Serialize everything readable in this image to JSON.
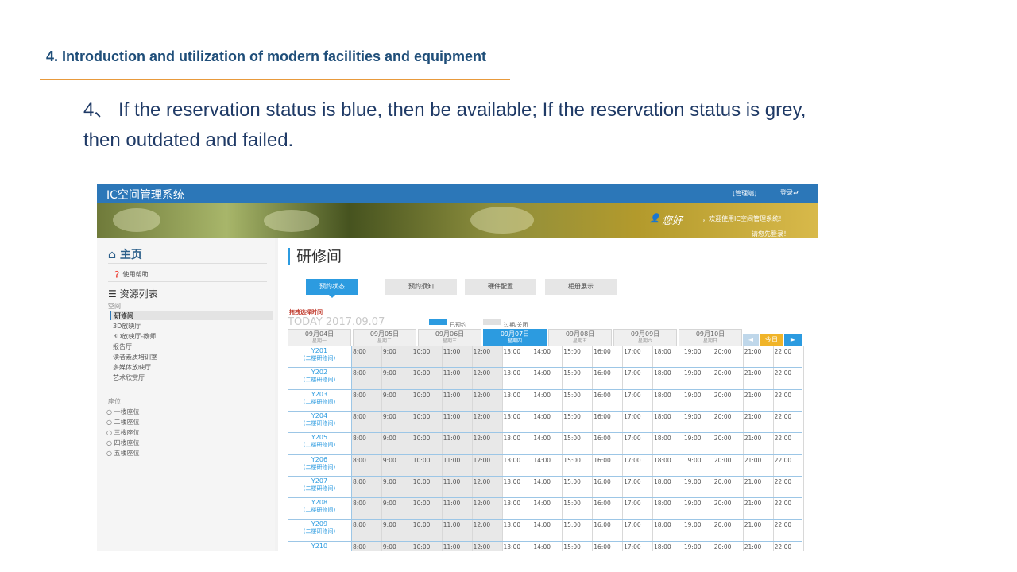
{
  "slide": {
    "heading": "4. Introduction and utilization of modern facilities and equipment",
    "body": "4、 If the reservation status is blue, then be available; If the reservation status is grey, then outdated and failed."
  },
  "app": {
    "title": "IC空间管理系统",
    "admin_link": "[管理端]",
    "login_link": "登录⮐",
    "welcome": "您好",
    "welcome_sub1": "，欢迎使用IC空间管理系统！",
    "welcome_sub2": "请您先登录！"
  },
  "sidebar": {
    "home": "主页",
    "help": "使用帮助",
    "resources": "资源列表",
    "group_space": "空间",
    "items": [
      "研修间",
      "3D放映厅",
      "3D放映厅-教师",
      "报告厅",
      "读者素质培训室",
      "多媒体放映厅",
      "艺术欣赏厅"
    ],
    "group_seat": "座位",
    "seats": [
      "一楼座位",
      "二楼座位",
      "三楼座位",
      "四楼座位",
      "五楼座位"
    ]
  },
  "main": {
    "room_title": "研修间",
    "tabs": [
      "预约状态",
      "预约须知",
      "硬件配置",
      "相册展示"
    ],
    "pick_label": "拖拽选择时间",
    "today": "TODAY 2017.09.07",
    "legend_booked": "已预约",
    "legend_expired": "过期/关闭",
    "days": [
      {
        "date": "09月04日",
        "week": "星期一"
      },
      {
        "date": "09月05日",
        "week": "星期二"
      },
      {
        "date": "09月06日",
        "week": "星期三"
      },
      {
        "date": "09月07日",
        "week": "星期四"
      },
      {
        "date": "09月08日",
        "week": "星期五"
      },
      {
        "date": "09月09日",
        "week": "星期六"
      },
      {
        "date": "09月10日",
        "week": "星期日"
      }
    ],
    "nav_prev": "◄",
    "nav_today": "今日",
    "nav_next": "►",
    "times": [
      "8:00",
      "9:00",
      "10:00",
      "11:00",
      "12:00",
      "13:00",
      "14:00",
      "15:00",
      "16:00",
      "17:00",
      "18:00",
      "19:00",
      "20:00",
      "21:00",
      "22:00"
    ],
    "rooms": [
      {
        "name": "Y201",
        "sub": "(二楼研修间)"
      },
      {
        "name": "Y202",
        "sub": "(二楼研修间)"
      },
      {
        "name": "Y203",
        "sub": "(二楼研修间)"
      },
      {
        "name": "Y204",
        "sub": "(二楼研修间)"
      },
      {
        "name": "Y205",
        "sub": "(二楼研修间)"
      },
      {
        "name": "Y206",
        "sub": "(二楼研修间)"
      },
      {
        "name": "Y207",
        "sub": "(二楼研修间)"
      },
      {
        "name": "Y208",
        "sub": "(二楼研修间)"
      },
      {
        "name": "Y209",
        "sub": "(二楼研修间)"
      },
      {
        "name": "Y210",
        "sub": "(二楼研修间)"
      }
    ]
  },
  "colors": {
    "available": "#2c9be0",
    "expired": "#e0e0e0",
    "topbar": "#2c77b8",
    "heading": "#1f4e79",
    "rule": "#e89a3c"
  },
  "icons": [
    "home-icon",
    "question-icon",
    "list-icon",
    "user-icon",
    "radio-icon",
    "login-icon"
  ]
}
